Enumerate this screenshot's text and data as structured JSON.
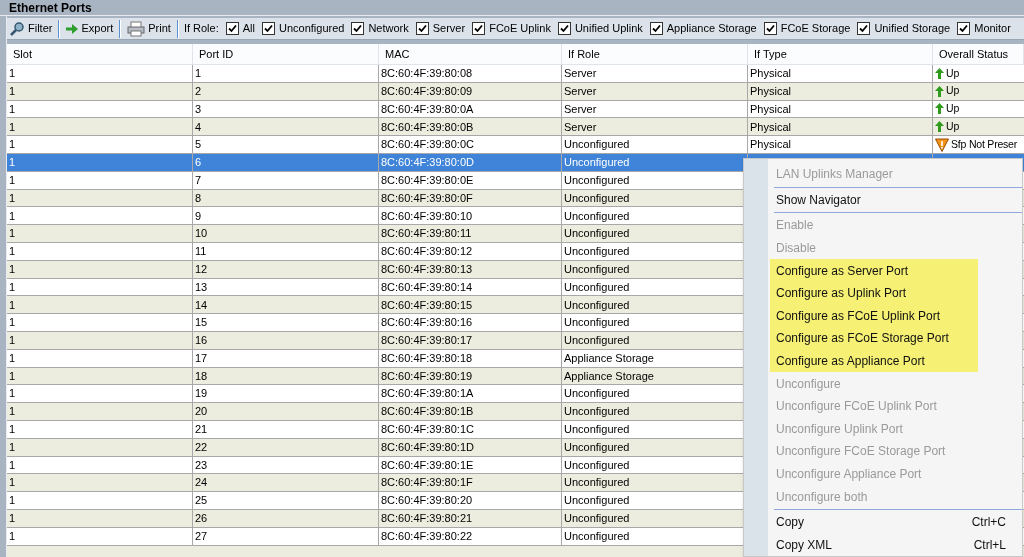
{
  "panel": {
    "title": "Ethernet Ports"
  },
  "toolbar": {
    "buttons": [
      {
        "kind": "filter",
        "label": "Filter"
      },
      {
        "kind": "export",
        "label": "Export"
      },
      {
        "kind": "print",
        "label": "Print"
      }
    ],
    "filter_label": "If Role:",
    "filters": [
      {
        "label": "All",
        "checked": true
      },
      {
        "label": "Unconfigured",
        "checked": true
      },
      {
        "label": "Network",
        "checked": true
      },
      {
        "label": "Server",
        "checked": true
      },
      {
        "label": "FCoE Uplink",
        "checked": true
      },
      {
        "label": "Unified Uplink",
        "checked": true
      },
      {
        "label": "Appliance Storage",
        "checked": true
      },
      {
        "label": "FCoE Storage",
        "checked": true
      },
      {
        "label": "Unified Storage",
        "checked": true
      },
      {
        "label": "Monitor",
        "checked": true
      }
    ]
  },
  "table": {
    "columns": [
      "Slot",
      "Port ID",
      "MAC",
      "If Role",
      "If Type",
      "Overall Status"
    ],
    "rows": [
      {
        "slot": "1",
        "port_id": "1",
        "mac": "8C:60:4F:39:80:08",
        "if_role": "Server",
        "if_type": "Physical",
        "status": {
          "kind": "up",
          "text": "Up"
        },
        "selected": false
      },
      {
        "slot": "1",
        "port_id": "2",
        "mac": "8C:60:4F:39:80:09",
        "if_role": "Server",
        "if_type": "Physical",
        "status": {
          "kind": "up",
          "text": "Up"
        },
        "selected": false
      },
      {
        "slot": "1",
        "port_id": "3",
        "mac": "8C:60:4F:39:80:0A",
        "if_role": "Server",
        "if_type": "Physical",
        "status": {
          "kind": "up",
          "text": "Up"
        },
        "selected": false
      },
      {
        "slot": "1",
        "port_id": "4",
        "mac": "8C:60:4F:39:80:0B",
        "if_role": "Server",
        "if_type": "Physical",
        "status": {
          "kind": "up",
          "text": "Up"
        },
        "selected": false
      },
      {
        "slot": "1",
        "port_id": "5",
        "mac": "8C:60:4F:39:80:0C",
        "if_role": "Unconfigured",
        "if_type": "Physical",
        "status": {
          "kind": "warning",
          "text": "Sfp Not Preser"
        },
        "selected": false
      },
      {
        "slot": "1",
        "port_id": "6",
        "mac": "8C:60:4F:39:80:0D",
        "if_role": "Unconfigured",
        "selected": true
      },
      {
        "slot": "1",
        "port_id": "7",
        "mac": "8C:60:4F:39:80:0E",
        "if_role": "Unconfigured",
        "selected": false
      },
      {
        "slot": "1",
        "port_id": "8",
        "mac": "8C:60:4F:39:80:0F",
        "if_role": "Unconfigured",
        "selected": false
      },
      {
        "slot": "1",
        "port_id": "9",
        "mac": "8C:60:4F:39:80:10",
        "if_role": "Unconfigured",
        "selected": false
      },
      {
        "slot": "1",
        "port_id": "10",
        "mac": "8C:60:4F:39:80:11",
        "if_role": "Unconfigured",
        "selected": false
      },
      {
        "slot": "1",
        "port_id": "11",
        "mac": "8C:60:4F:39:80:12",
        "if_role": "Unconfigured",
        "selected": false
      },
      {
        "slot": "1",
        "port_id": "12",
        "mac": "8C:60:4F:39:80:13",
        "if_role": "Unconfigured",
        "selected": false
      },
      {
        "slot": "1",
        "port_id": "13",
        "mac": "8C:60:4F:39:80:14",
        "if_role": "Unconfigured",
        "selected": false
      },
      {
        "slot": "1",
        "port_id": "14",
        "mac": "8C:60:4F:39:80:15",
        "if_role": "Unconfigured",
        "selected": false
      },
      {
        "slot": "1",
        "port_id": "15",
        "mac": "8C:60:4F:39:80:16",
        "if_role": "Unconfigured",
        "selected": false
      },
      {
        "slot": "1",
        "port_id": "16",
        "mac": "8C:60:4F:39:80:17",
        "if_role": "Unconfigured",
        "selected": false
      },
      {
        "slot": "1",
        "port_id": "17",
        "mac": "8C:60:4F:39:80:18",
        "if_role": "Appliance Storage",
        "selected": false
      },
      {
        "slot": "1",
        "port_id": "18",
        "mac": "8C:60:4F:39:80:19",
        "if_role": "Appliance Storage",
        "selected": false
      },
      {
        "slot": "1",
        "port_id": "19",
        "mac": "8C:60:4F:39:80:1A",
        "if_role": "Unconfigured",
        "selected": false
      },
      {
        "slot": "1",
        "port_id": "20",
        "mac": "8C:60:4F:39:80:1B",
        "if_role": "Unconfigured",
        "selected": false
      },
      {
        "slot": "1",
        "port_id": "21",
        "mac": "8C:60:4F:39:80:1C",
        "if_role": "Unconfigured",
        "selected": false
      },
      {
        "slot": "1",
        "port_id": "22",
        "mac": "8C:60:4F:39:80:1D",
        "if_role": "Unconfigured",
        "selected": false
      },
      {
        "slot": "1",
        "port_id": "23",
        "mac": "8C:60:4F:39:80:1E",
        "if_role": "Unconfigured",
        "selected": false
      },
      {
        "slot": "1",
        "port_id": "24",
        "mac": "8C:60:4F:39:80:1F",
        "if_role": "Unconfigured",
        "selected": false
      },
      {
        "slot": "1",
        "port_id": "25",
        "mac": "8C:60:4F:39:80:20",
        "if_role": "Unconfigured",
        "selected": false
      },
      {
        "slot": "1",
        "port_id": "26",
        "mac": "8C:60:4F:39:80:21",
        "if_role": "Unconfigured",
        "selected": false
      },
      {
        "slot": "1",
        "port_id": "27",
        "mac": "8C:60:4F:39:80:22",
        "if_role": "Unconfigured",
        "selected": false
      }
    ]
  },
  "context_menu": {
    "items": [
      {
        "kind": "item",
        "label": "LAN Uplinks Manager",
        "disabled": true,
        "highlighted": false
      },
      {
        "kind": "separator"
      },
      {
        "kind": "item",
        "label": "Show Navigator",
        "disabled": false,
        "highlighted": false
      },
      {
        "kind": "separator"
      },
      {
        "kind": "item",
        "label": "Enable",
        "disabled": true,
        "highlighted": false
      },
      {
        "kind": "item",
        "label": "Disable",
        "disabled": true,
        "highlighted": false
      },
      {
        "kind": "item",
        "label": "Configure as Server Port",
        "disabled": false,
        "highlighted": true
      },
      {
        "kind": "item",
        "label": "Configure as Uplink Port",
        "disabled": false,
        "highlighted": true
      },
      {
        "kind": "item",
        "label": "Configure as FCoE Uplink Port",
        "disabled": false,
        "highlighted": true
      },
      {
        "kind": "item",
        "label": "Configure as FCoE Storage Port",
        "disabled": false,
        "highlighted": true
      },
      {
        "kind": "item",
        "label": "Configure as Appliance Port",
        "disabled": false,
        "highlighted": true
      },
      {
        "kind": "item",
        "label": "Unconfigure",
        "disabled": true,
        "highlighted": false
      },
      {
        "kind": "item",
        "label": "Unconfigure FCoE Uplink Port",
        "disabled": true,
        "highlighted": false
      },
      {
        "kind": "item",
        "label": "Unconfigure Uplink Port",
        "disabled": true,
        "highlighted": false
      },
      {
        "kind": "item",
        "label": "Unconfigure FCoE Storage Port",
        "disabled": true,
        "highlighted": false
      },
      {
        "kind": "item",
        "label": "Unconfigure Appliance Port",
        "disabled": true,
        "highlighted": false
      },
      {
        "kind": "item",
        "label": "Unconfigure both",
        "disabled": true,
        "highlighted": false
      },
      {
        "kind": "separator"
      },
      {
        "kind": "item",
        "label": "Copy",
        "shortcut": "Ctrl+C",
        "disabled": false,
        "highlighted": false
      },
      {
        "kind": "item",
        "label": "Copy XML",
        "shortcut": "Ctrl+L",
        "disabled": false,
        "highlighted": false
      }
    ]
  }
}
